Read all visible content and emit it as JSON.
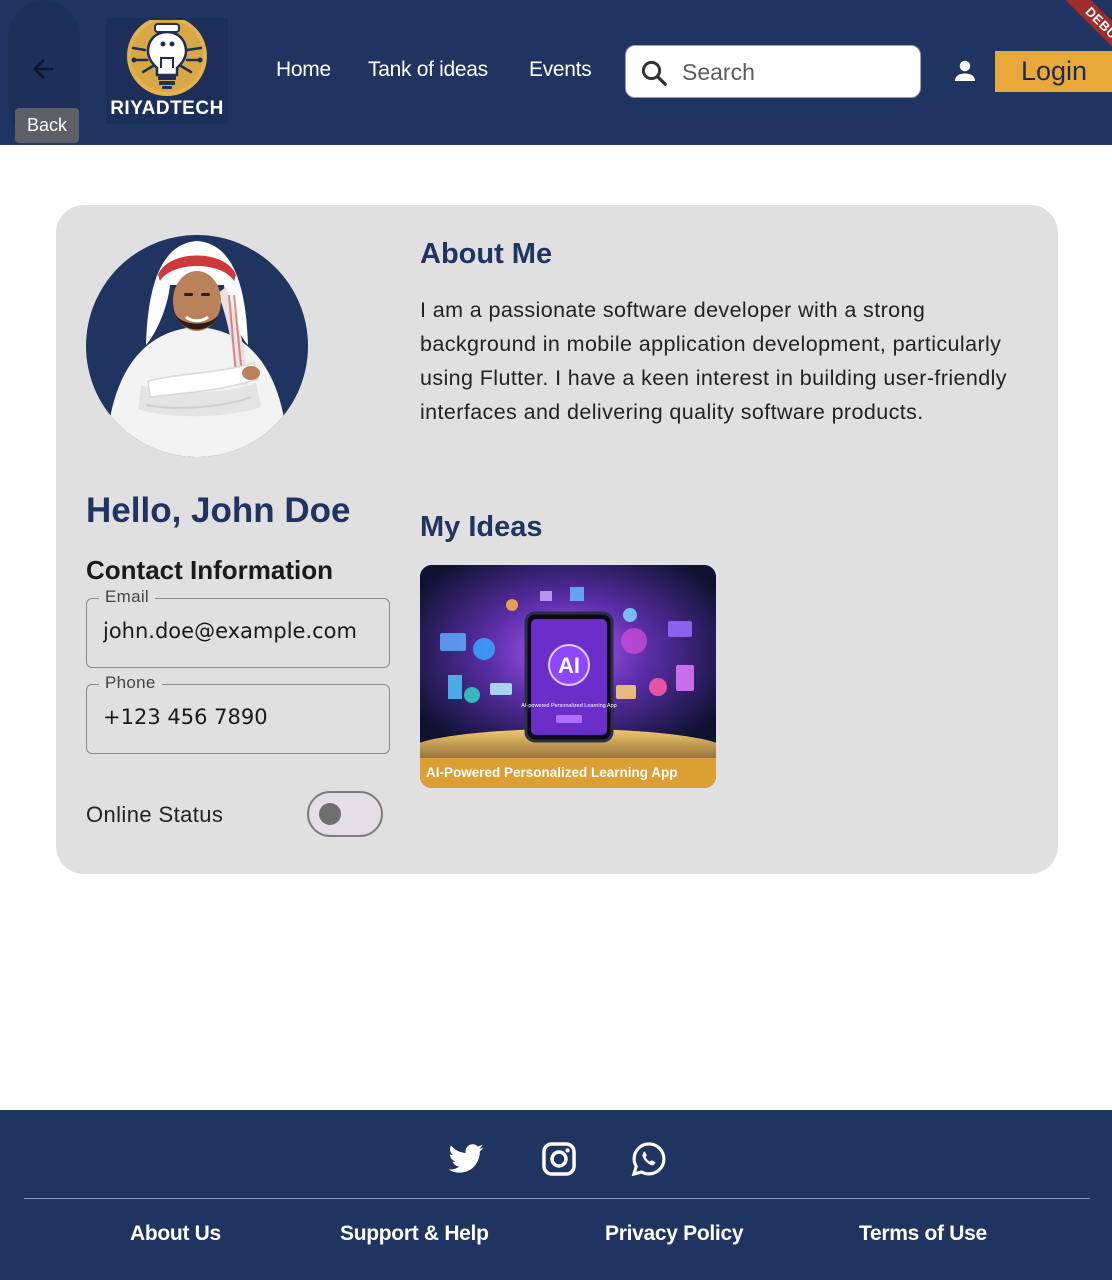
{
  "header": {
    "back_tooltip": "Back",
    "logo_text": "RIYADTECH",
    "nav": [
      "Home",
      "Tank of ideas",
      "Events"
    ],
    "search_placeholder": "Search",
    "login_label": "Login",
    "debug_label": "DEBUG"
  },
  "profile": {
    "greeting": "Hello, John Doe",
    "contact_title": "Contact Information",
    "email_label": "Email",
    "email_value": "john.doe@example.com",
    "phone_label": "Phone",
    "phone_value": "+123 456 7890",
    "online_status_label": "Online Status",
    "online_status_on": false
  },
  "about": {
    "title": "About Me",
    "text": "I am a passionate software developer with a strong background in mobile application development, particularly using Flutter. I have a keen interest in building user-friendly interfaces and delivering quality software products."
  },
  "ideas": {
    "title": "My Ideas",
    "items": [
      {
        "caption": "AI-Powered Personalized Learning App",
        "image_label": "AI",
        "image_subtitle": "AI-powered Personalized Learning App"
      }
    ]
  },
  "footer": {
    "social_icons": [
      "twitter-icon",
      "instagram-icon",
      "whatsapp-icon"
    ],
    "links": [
      "About Us",
      "Support & Help",
      "Privacy Policy",
      "Terms of Use"
    ]
  },
  "colors": {
    "primary": "#1f3461",
    "accent": "#e9a83a",
    "card_bg": "#e0e0e0",
    "debug": "#a12c2c"
  }
}
